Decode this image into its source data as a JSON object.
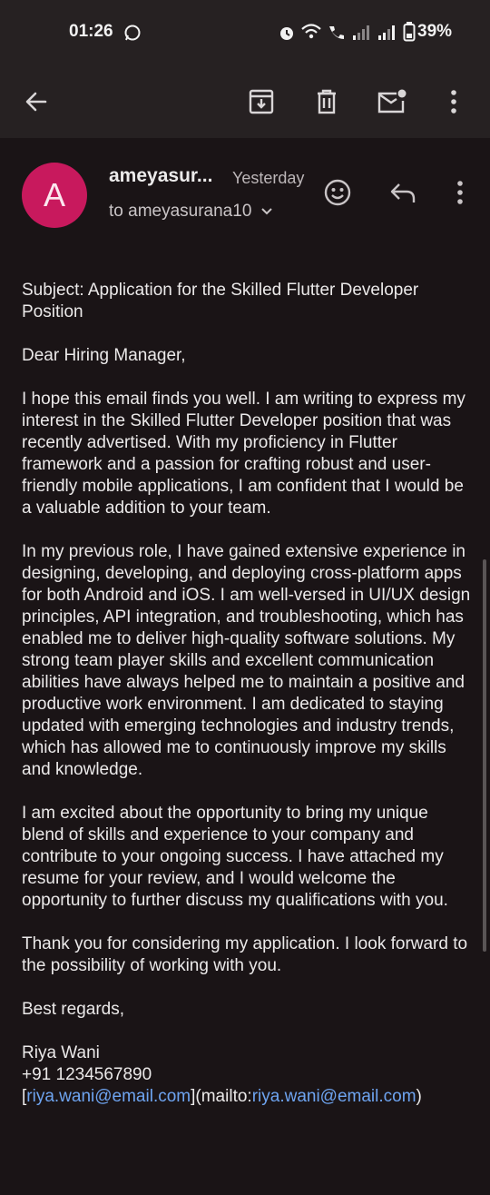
{
  "status": {
    "time": "01:26",
    "battery": "39%"
  },
  "toolbar": {
    "back_icon": "arrow-left-icon",
    "archive_icon": "archive-icon",
    "delete_icon": "trash-icon",
    "unread_icon": "mark-unread-icon",
    "more_icon": "more-vert-icon"
  },
  "email": {
    "avatar_letter": "A",
    "avatar_color": "#c8195d",
    "sender": "ameyasur...",
    "when": "Yesterday",
    "recipient": "to ameyasurana10",
    "paragraphs": [
      " Subject: Application for the Skilled Flutter Developer Position",
      "Dear Hiring Manager,",
      "I hope this email finds you well. I am writing to express my interest in the Skilled Flutter Developer position that was recently advertised. With my proficiency in Flutter framework and a passion for crafting robust and user-friendly mobile applications, I am confident that I would be a valuable addition to your team.",
      "In my previous role, I have gained extensive experience in designing, developing, and deploying cross-platform apps for both Android and iOS. I am well-versed in UI/UX design principles, API integration, and troubleshooting, which has enabled me to deliver high-quality software solutions. My strong team player skills and excellent communication abilities have always helped me to maintain a positive and productive work environment. I am dedicated to staying updated with emerging technologies and industry trends, which has allowed me to continuously improve my skills and knowledge.",
      "I am excited about the opportunity to bring my unique blend of skills and experience to your company and contribute to your ongoing success. I have attached my resume for your review, and I would welcome the opportunity to further discuss my qualifications with you.",
      "Thank you for considering my application. I look forward to the possibility of working with you.",
      "Best regards,"
    ],
    "signature_name": "Riya Wani",
    "signature_phone": "+91 1234567890",
    "signature_bracket_open": "[",
    "signature_link_text": "riya.wani@email.com",
    "signature_middle": "](mailto:",
    "signature_link_url": "riya.wani@email.com",
    "signature_close": ")"
  },
  "colors": {
    "background": "#1a1416",
    "toolbar": "#262122",
    "link": "#6ea4f0"
  }
}
